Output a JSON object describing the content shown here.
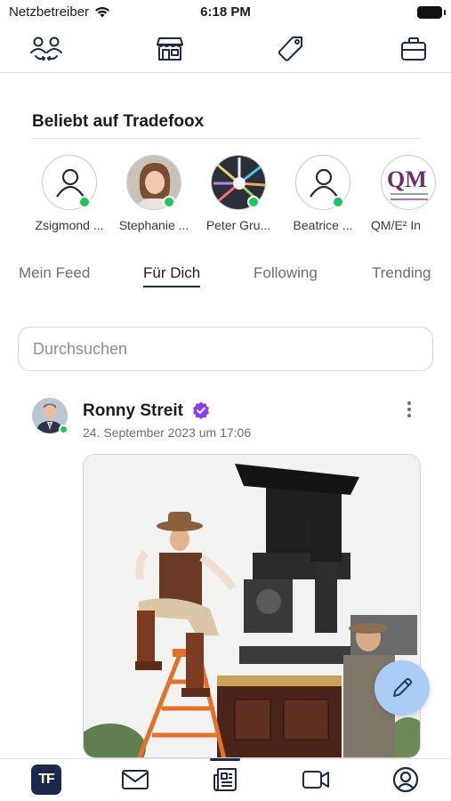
{
  "status_bar": {
    "carrier": "Netzbetreiber",
    "time": "6:18 PM"
  },
  "top_nav": {
    "icons": [
      "people-icon",
      "store-icon",
      "tag-icon",
      "briefcase-icon"
    ]
  },
  "popular": {
    "title": "Beliebt auf Tradefoox",
    "users": [
      {
        "name": "Zsigmond ...",
        "online": true,
        "avatar": "default"
      },
      {
        "name": "Stephanie ...",
        "online": true,
        "avatar": "photo"
      },
      {
        "name": "Peter Gru...",
        "online": true,
        "avatar": "photo"
      },
      {
        "name": "Beatrice ...",
        "online": true,
        "avatar": "default"
      },
      {
        "name": "QM/E² In",
        "online": false,
        "avatar": "logo",
        "logo_text": "QM"
      }
    ]
  },
  "feed_tabs": {
    "active": "Für Dich",
    "items": [
      "Mein Feed",
      "Für Dich",
      "Following",
      "Trending"
    ]
  },
  "search": {
    "placeholder": "Durchsuchen",
    "value": ""
  },
  "post": {
    "author": "Ronny Streit",
    "verified": true,
    "date": "24. September 2023 um 17:06",
    "online": true
  },
  "bottom_nav": {
    "items": [
      "tradefoox-logo",
      "mail-icon",
      "newspaper-icon",
      "video-icon",
      "profile-icon"
    ],
    "logo_text": "TF",
    "active": "newspaper-icon"
  },
  "colors": {
    "accent": "#1b2a4a",
    "online": "#1fc65a",
    "verified": "#8a3ff0",
    "fab": "#a9cdf5"
  }
}
